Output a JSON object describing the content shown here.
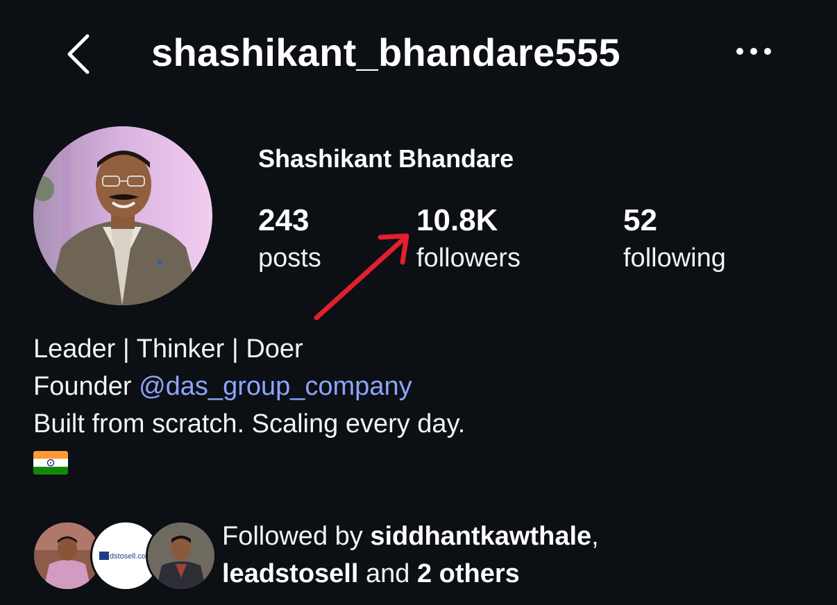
{
  "header": {
    "username": "shashikant_bhandare555",
    "back_icon": "chevron-left-icon",
    "more_icon": "more-horizontal-icon"
  },
  "profile": {
    "display_name": "Shashikant Bhandare",
    "stats": [
      {
        "value": "243",
        "label": "posts"
      },
      {
        "value": "10.8K",
        "label": "followers"
      },
      {
        "value": "52",
        "label": "following"
      }
    ]
  },
  "annotation": {
    "arrow_color": "#e0202e"
  },
  "bio": {
    "line1": "Leader | Thinker | Doer",
    "founder_prefix": "Founder ",
    "mention": "@das_group_company",
    "line3": "Built from scratch. Scaling every day.",
    "flag": "india-flag-icon"
  },
  "followed_by": {
    "prefix": "Followed by ",
    "user1": "siddhantkawthale",
    "sep": ",",
    "user2": "leadstosell",
    "mid": " and ",
    "others": "2 others",
    "avatar_logo_text": "dstosell.com"
  },
  "colors": {
    "background": "#0c0f14",
    "mention": "#8ea4ff",
    "arrow": "#e0202e"
  }
}
